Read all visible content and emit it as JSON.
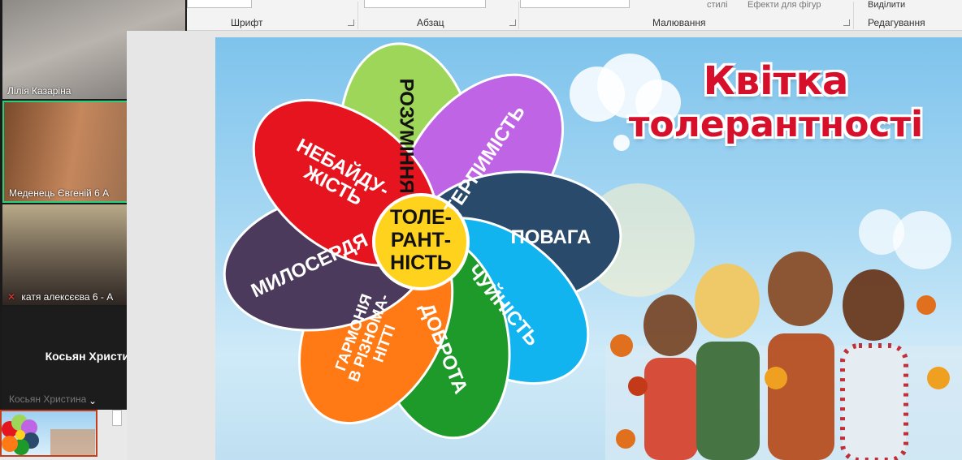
{
  "ribbon": {
    "groups": [
      "Шрифт",
      "Абзац",
      "Малювання",
      "Редагування"
    ],
    "top_items": [
      "стилі",
      "Ефекти для фігур",
      "Виділити"
    ]
  },
  "participants": [
    {
      "name": "Лілія Казаріна"
    },
    {
      "name": "Меденець Євгеній 6 А"
    },
    {
      "name": "катя алексєєва 6 - А"
    },
    {
      "name": "Косьян Христина",
      "sub": "Косьян Христина"
    }
  ],
  "slide": {
    "title_line1": "Квітка",
    "title_line2": "толерантності",
    "center": [
      "ТОЛЕ-",
      "РАНТ-",
      "НІСТЬ"
    ],
    "petals": [
      {
        "lines": [
          "РОЗУМІННЯ"
        ],
        "color": "#9ed659"
      },
      {
        "lines": [
          "ТЕРПИМІСТЬ"
        ],
        "color": "#c064e6"
      },
      {
        "lines": [
          "ПОВАГА"
        ],
        "color": "#2a4a6c"
      },
      {
        "lines": [
          "ЧУЙНІСТЬ"
        ],
        "color": "#12b4ef"
      },
      {
        "lines": [
          "ДОБРОТА"
        ],
        "color": "#1e9a2a"
      },
      {
        "lines": [
          "ГАРМОНІЯ",
          "В РІЗНОМА-",
          "НІТТІ"
        ],
        "color": "#ff7a14"
      },
      {
        "lines": [
          "МИЛОСЕРДЯ"
        ],
        "color": "#4b3a5c"
      },
      {
        "lines": [
          "НЕБАЙДУ-",
          "ЖІСТЬ"
        ],
        "color": "#e5141e"
      }
    ],
    "center_color": "#ffd21e"
  }
}
